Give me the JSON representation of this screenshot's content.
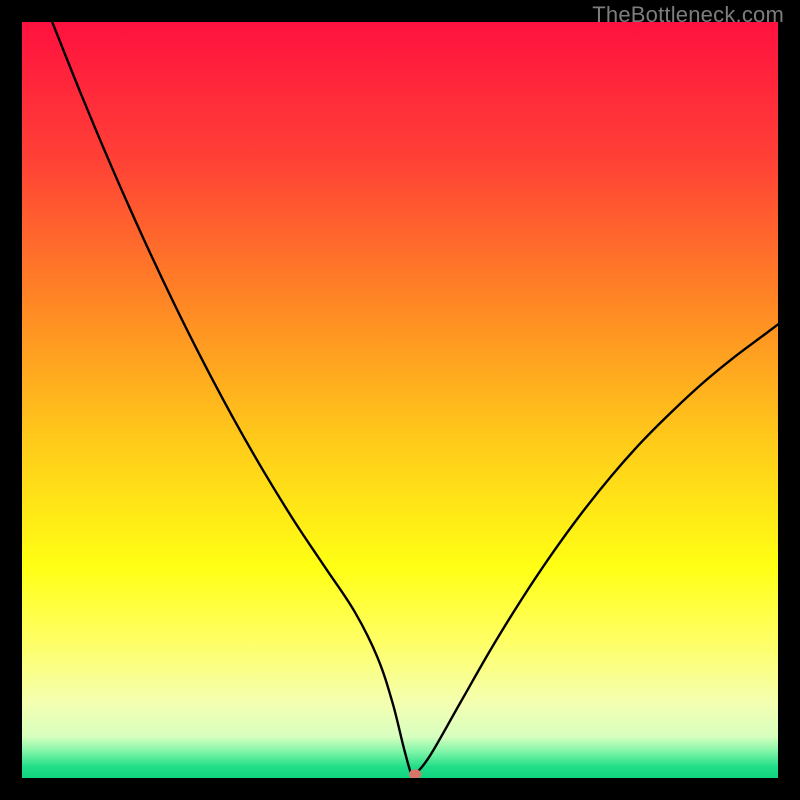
{
  "branding": {
    "watermark": "TheBottleneck.com"
  },
  "chart_data": {
    "type": "line",
    "title": "",
    "xlabel": "",
    "ylabel": "",
    "xlim": [
      0,
      100
    ],
    "ylim": [
      0,
      100
    ],
    "grid": false,
    "legend": false,
    "background": {
      "type": "vertical-gradient",
      "stops": [
        {
          "pos": 0.0,
          "color": "#ff113f"
        },
        {
          "pos": 0.18,
          "color": "#ff4036"
        },
        {
          "pos": 0.38,
          "color": "#ff8a24"
        },
        {
          "pos": 0.55,
          "color": "#ffc91a"
        },
        {
          "pos": 0.72,
          "color": "#ffff14"
        },
        {
          "pos": 0.82,
          "color": "#ffff66"
        },
        {
          "pos": 0.9,
          "color": "#f4ffb0"
        },
        {
          "pos": 0.945,
          "color": "#d8ffc0"
        },
        {
          "pos": 0.965,
          "color": "#80f5a8"
        },
        {
          "pos": 0.985,
          "color": "#22de88"
        },
        {
          "pos": 1.0,
          "color": "#0fd47e"
        }
      ]
    },
    "series": [
      {
        "name": "bottleneck-curve",
        "color": "#000000",
        "x": [
          4,
          8,
          12,
          16,
          20,
          24,
          28,
          32,
          36,
          40,
          44,
          47,
          49,
          50.5,
          51.5,
          52,
          54,
          58,
          62,
          66,
          70,
          74,
          78,
          82,
          86,
          90,
          94,
          98,
          100
        ],
        "y": [
          100,
          90,
          80.5,
          71.5,
          63,
          55,
          47.5,
          40.5,
          34,
          28,
          22,
          16,
          10,
          4,
          0.5,
          0.5,
          3,
          10,
          17,
          23.5,
          29.5,
          35,
          40,
          44.5,
          48.5,
          52.2,
          55.5,
          58.5,
          60
        ]
      }
    ],
    "marker": {
      "name": "optimal-point",
      "x": 52,
      "y": 0.5,
      "color": "#d9746a",
      "rx": 6,
      "ry": 5
    }
  }
}
